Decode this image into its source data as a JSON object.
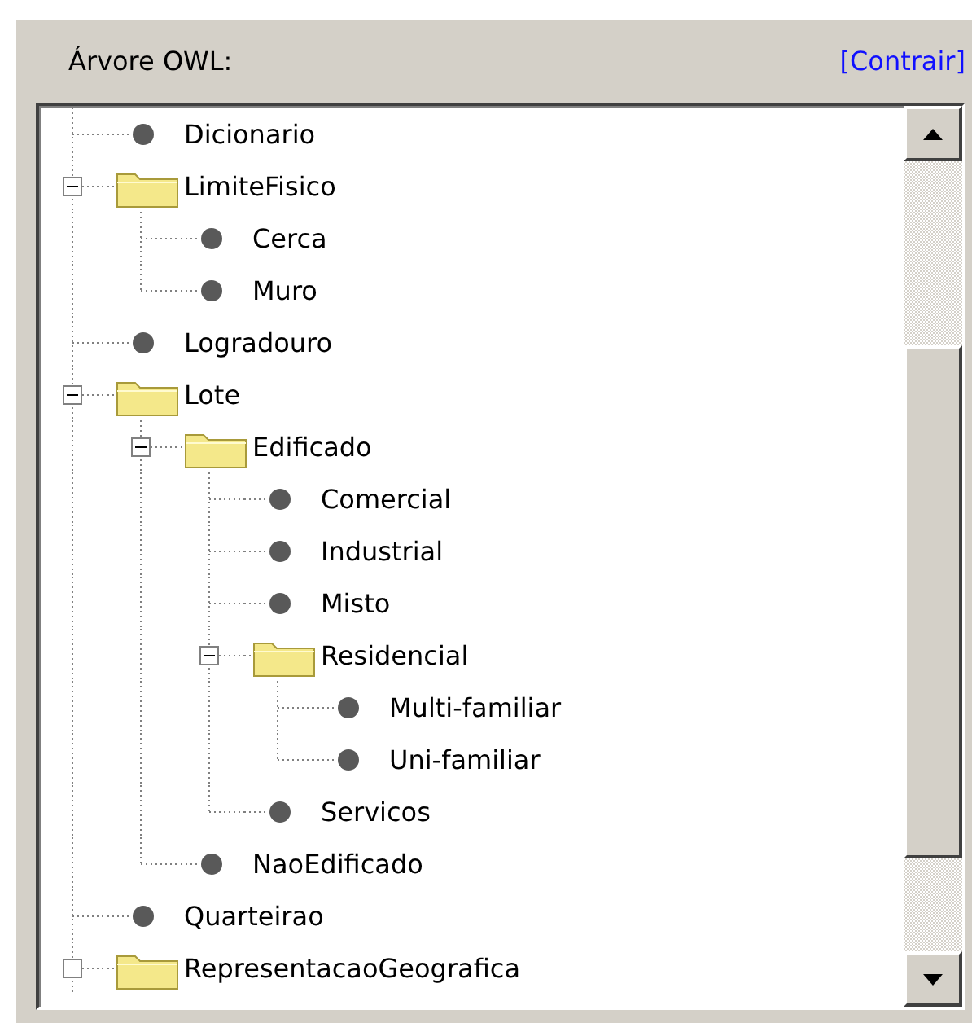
{
  "panel": {
    "title": "Árvore OWL:",
    "toggle_link": "[Contrair]"
  },
  "tree": [
    {
      "label": "Dicionario",
      "kind": "class"
    },
    {
      "label": "LimiteFisico",
      "kind": "folder",
      "expanded": true,
      "children": [
        {
          "label": "Cerca",
          "kind": "class"
        },
        {
          "label": "Muro",
          "kind": "class"
        }
      ]
    },
    {
      "label": "Logradouro",
      "kind": "class"
    },
    {
      "label": "Lote",
      "kind": "folder",
      "expanded": true,
      "children": [
        {
          "label": "Edificado",
          "kind": "folder",
          "expanded": true,
          "children": [
            {
              "label": "Comercial",
              "kind": "class"
            },
            {
              "label": "Industrial",
              "kind": "class"
            },
            {
              "label": "Misto",
              "kind": "class"
            },
            {
              "label": "Residencial",
              "kind": "folder",
              "expanded": true,
              "children": [
                {
                  "label": "Multi-familiar",
                  "kind": "class"
                },
                {
                  "label": "Uni-familiar",
                  "kind": "class"
                }
              ]
            },
            {
              "label": "Servicos",
              "kind": "class"
            }
          ]
        },
        {
          "label": "NaoEdificado",
          "kind": "class"
        }
      ]
    },
    {
      "label": "Quarteirao",
      "kind": "class"
    },
    {
      "label": "RepresentacaoGeografica",
      "kind": "folder"
    }
  ]
}
